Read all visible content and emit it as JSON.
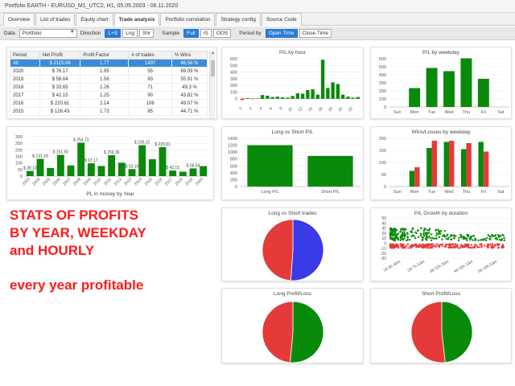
{
  "window": {
    "title": "Portfolio EARTH - EURUSD_M1_UTC2, H1, 05.05.2003 - 06.11.2020"
  },
  "tabs": [
    "Overview",
    "List of trades",
    "Equity chart",
    "Trade analysis",
    "Portfolio correlation",
    "Strategy config",
    "Source Code"
  ],
  "active_tab": "Trade analysis",
  "toolbar": {
    "data_label": "Data",
    "data_value": "Portfolio",
    "direction_label": "Direction",
    "direction_options": [
      "L+S",
      "Lng",
      "Shr"
    ],
    "direction_selected": "L+S",
    "sample_label": "Sample",
    "sample_options": [
      "Full",
      "IS",
      "OOS"
    ],
    "sample_selected": "Full",
    "period_label": "Period by",
    "period_options": [
      "Open Time",
      "Close Time"
    ],
    "period_selected": "Open Time"
  },
  "table": {
    "headers": [
      "Period",
      "Net Profit",
      "Profit Factor",
      "# of trades",
      "% Wins"
    ],
    "rows": [
      [
        "All",
        "$ 2115.06",
        "1.77",
        "1497",
        "48.56 %"
      ],
      [
        "2020",
        "$ 76.17",
        "1.95",
        "55",
        "69.09 %"
      ],
      [
        "2019",
        "$ 58.64",
        "1.56",
        "93",
        "55.91 %"
      ],
      [
        "2018",
        "$ 33.65",
        "1.26",
        "71",
        "49.3 %"
      ],
      [
        "2017",
        "$ 42.15",
        "1.25",
        "90",
        "43.82 %"
      ],
      [
        "2016",
        "$ 220.61",
        "2.14",
        "108",
        "49.07 %"
      ],
      [
        "2015",
        "$ 128.43",
        "1.73",
        "85",
        "44.71 %"
      ]
    ]
  },
  "promo": {
    "line1": "STATS OF PROFITS",
    "line2": "BY YEAR, WEEKDAY",
    "line3": "and HOURLY",
    "line4": "every year profitable"
  },
  "colors": {
    "green": "#0a8a0a",
    "red": "#e53a3a",
    "blue": "#3a3ae8",
    "selected": "#3b8bdd"
  },
  "chart_data": [
    {
      "id": "year",
      "type": "bar",
      "title": "PL in money by Year",
      "categories": [
        "2003",
        "2004",
        "2005",
        "2006",
        "2007",
        "2008",
        "2009",
        "2010",
        "2011",
        "2012",
        "2013",
        "2014",
        "2015",
        "2016",
        "2017",
        "2018",
        "2019",
        "2020"
      ],
      "values": [
        39.13,
        131.18,
        62,
        161.5,
        81,
        254.73,
        97.17,
        77,
        159.36,
        102,
        53.1,
        235.22,
        128.43,
        220.61,
        42.15,
        33.65,
        58.64,
        76.17
      ],
      "labels": [
        "$ 39.13",
        "$ 131.18",
        "",
        "$ 161.50",
        "",
        "$ 254.73",
        "$ 97.17",
        "",
        "$ 159.36",
        "",
        "$ 53.10",
        "$ 235.22",
        "",
        "$ 220.61",
        "$ 42.15",
        "",
        "$ 58.64",
        ""
      ],
      "yticks": [
        0,
        50,
        100,
        150,
        200,
        250,
        300
      ],
      "ylim": [
        0,
        300
      ]
    },
    {
      "id": "hour",
      "type": "bar",
      "title": "P/L by hour",
      "categories": [
        "0",
        "1",
        "2",
        "3",
        "4",
        "5",
        "6",
        "7",
        "8",
        "9",
        "10",
        "11",
        "12",
        "13",
        "14",
        "15",
        "16",
        "17",
        "18",
        "19",
        "20",
        "21",
        "22",
        "23"
      ],
      "xtick_labels": [
        "0",
        "2",
        "4",
        "6",
        "8",
        "10",
        "12",
        "14",
        "16",
        "18",
        "20",
        "22"
      ],
      "values": [
        -20,
        10,
        -8,
        5,
        55,
        45,
        25,
        30,
        20,
        15,
        40,
        80,
        75,
        130,
        140,
        60,
        585,
        160,
        245,
        220,
        60,
        30,
        15,
        25
      ],
      "yticks": [
        0,
        100,
        200,
        300,
        400,
        500,
        600
      ],
      "ylim": [
        -100,
        600
      ]
    },
    {
      "id": "weekday",
      "type": "bar",
      "title": "P/L by weekday",
      "categories": [
        "Sun",
        "Mon",
        "Tue",
        "Wed",
        "Thu",
        "Fri",
        "Sat"
      ],
      "values": [
        0,
        235,
        485,
        445,
        605,
        350,
        0
      ],
      "yticks": [
        0,
        100,
        200,
        300,
        400,
        500,
        600
      ],
      "ylim": [
        0,
        600
      ]
    },
    {
      "id": "ls",
      "type": "bar",
      "title": "Long vs Short P/L",
      "categories": [
        "Long P/L",
        "Short P/L"
      ],
      "values": [
        1200,
        890
      ],
      "yticks": [
        0,
        200,
        400,
        600,
        800,
        1000,
        1200,
        1400
      ],
      "ylim": [
        0,
        1400
      ]
    },
    {
      "id": "wl",
      "type": "bar",
      "title": "Wins/Losses by weekday",
      "categories": [
        "Sun",
        "Mon",
        "Tue",
        "Wed",
        "Thu",
        "Fri",
        "Sat"
      ],
      "series": [
        {
          "values": [
            0,
            65,
            160,
            185,
            155,
            185,
            0
          ]
        },
        {
          "values": [
            0,
            80,
            190,
            190,
            180,
            145,
            0
          ]
        }
      ],
      "yticks": [
        0,
        50,
        100,
        150,
        200
      ],
      "ylim": [
        0,
        200
      ]
    },
    {
      "id": "lst",
      "type": "pie",
      "title": "Long vs Short trades",
      "values": [
        765,
        732
      ],
      "colors": [
        "#3a3ae8",
        "#e53a3a"
      ]
    },
    {
      "id": "growth",
      "type": "scatter",
      "title": "P/L Growth by duration",
      "xtick_labels": [
        "1d 3h 40m",
        "2d 7h 53m",
        "3d 12h 20m",
        "4d 16h 13m",
        "5d 18h 53m"
      ],
      "yticks": [
        -30,
        -20,
        -10,
        0,
        10,
        20,
        30,
        40,
        50
      ]
    },
    {
      "id": "lpl",
      "type": "pie",
      "title": "Long Profit/Loss",
      "values": [
        1070,
        1010
      ],
      "colors": [
        "#0a8a0a",
        "#e53a3a"
      ]
    },
    {
      "id": "spl",
      "type": "pie",
      "title": "Short Profit/Loss",
      "values": [
        930,
        1000
      ],
      "colors": [
        "#0a8a0a",
        "#e53a3a"
      ]
    }
  ]
}
